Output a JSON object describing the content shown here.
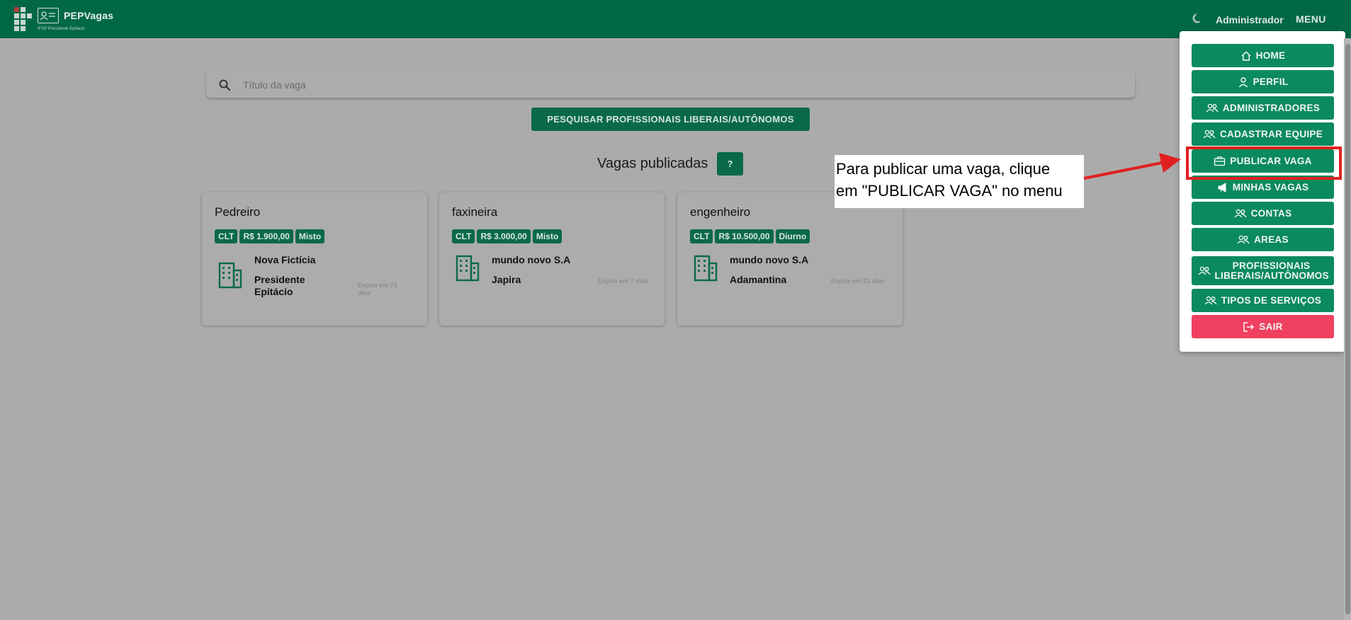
{
  "header": {
    "brand": "PEPVagas",
    "subtitle": "IFSP Presidente Epitácio",
    "user": "Administrador",
    "menu_label": "MENU"
  },
  "search": {
    "placeholder": "Título da vaga"
  },
  "search_professionals_label": "PESQUISAR PROFISSIONAIS LIBERAIS/AUTÔNOMOS",
  "section_title": "Vagas publicadas",
  "help_label": "?",
  "jobs": [
    {
      "title": "Pedreiro",
      "badges": [
        "CLT",
        "R$ 1.900,00",
        "Misto"
      ],
      "company": "Nova Fictícia",
      "city": "Presidente Epitácio",
      "expiry": "Expira em 73 dias"
    },
    {
      "title": "faxineira",
      "badges": [
        "CLT",
        "R$ 3.000,00",
        "Misto"
      ],
      "company": "mundo novo S.A",
      "city": "Japira",
      "expiry": "Expira em 7 dias"
    },
    {
      "title": "engenheiro",
      "badges": [
        "CLT",
        "R$ 10.500,00",
        "Diurno"
      ],
      "company": "mundo novo S.A",
      "city": "Adamantina",
      "expiry": "Expira em 23 dias"
    }
  ],
  "menu": {
    "items": [
      {
        "label": "HOME",
        "icon": "home-icon"
      },
      {
        "label": "PERFIL",
        "icon": "user-icon"
      },
      {
        "label": "ADMINISTRADORES",
        "icon": "users-icon"
      },
      {
        "label": "CADASTRAR EQUIPE",
        "icon": "users-icon"
      },
      {
        "label": "PUBLICAR VAGA",
        "icon": "briefcase-icon"
      },
      {
        "label": "MINHAS VAGAS",
        "icon": "megaphone-icon"
      },
      {
        "label": "CONTAS",
        "icon": "users-icon"
      },
      {
        "label": "AREAS",
        "icon": "users-icon"
      },
      {
        "label": "PROFISSIONAIS LIBERAIS/AUTÔNOMOS",
        "icon": "users-icon"
      },
      {
        "label": "TIPOS DE SERVIÇOS",
        "icon": "users-icon"
      },
      {
        "label": "SAIR",
        "icon": "logout-icon"
      }
    ]
  },
  "annotation": {
    "line1": "Para publicar uma vaga, clique",
    "line2": "em \"PUBLICAR VAGA\" no menu"
  },
  "colors": {
    "primary": "#006845",
    "button": "#0b8a5e",
    "danger": "#ef4060",
    "highlight": "#e12020",
    "overlay_bg": "#ababab"
  }
}
